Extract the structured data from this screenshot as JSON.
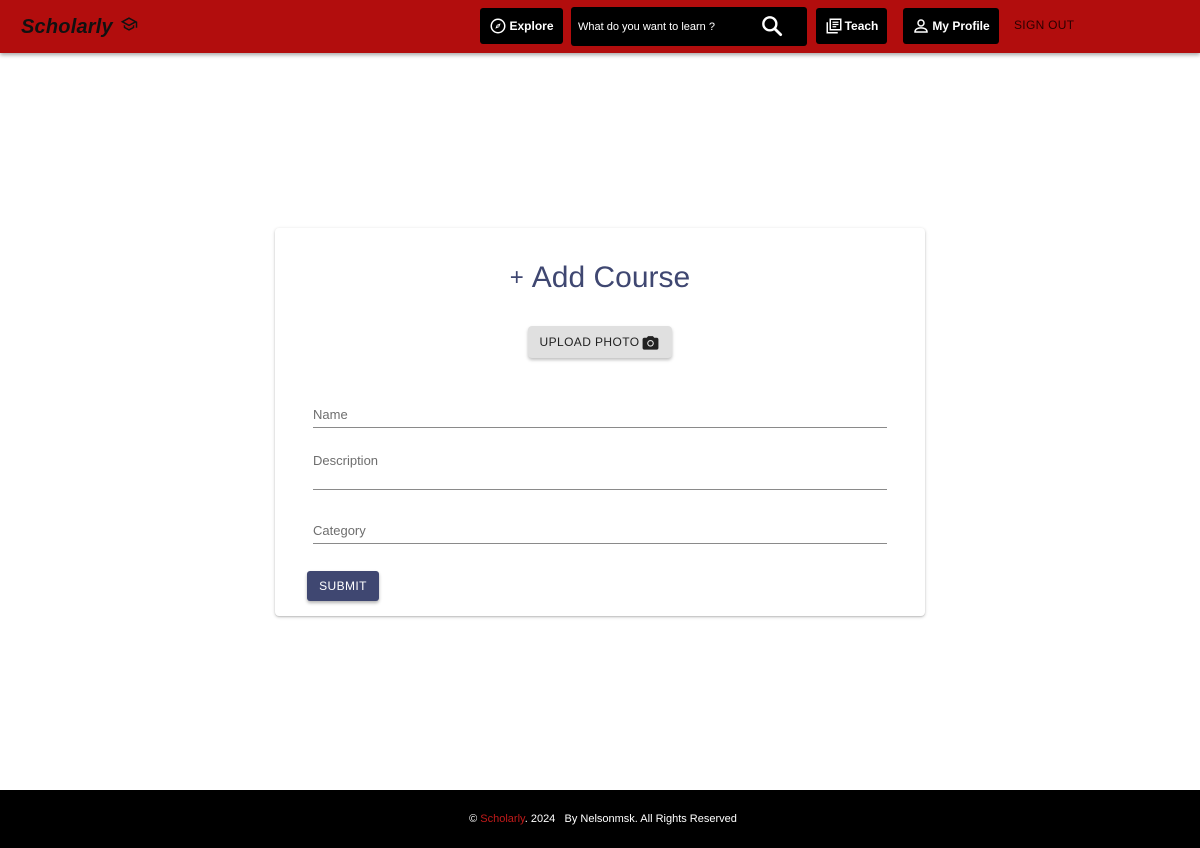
{
  "header": {
    "brand": "Scholarly",
    "brand_icon": "graduation-cap-icon",
    "explore_label": "Explore",
    "search_placeholder": "What do you want to learn ?",
    "teach_label": "Teach",
    "profile_label": "My Profile",
    "signout_label": "SIGN OUT"
  },
  "form": {
    "title_prefix": "+",
    "title": "Add Course",
    "upload_label": "UPLOAD PHOTO",
    "name_placeholder": "Name",
    "description_placeholder": "Description",
    "category_placeholder": "Category",
    "submit_label": "SUBMIT"
  },
  "footer": {
    "copyright": "©",
    "brand": "Scholarly",
    "year_text": ". 2024",
    "credit": "By Nelsonmsk. All Rights Reserved"
  },
  "colors": {
    "header_bg": "#b20d0d",
    "accent": "#3f4771",
    "footer_bg": "#000000"
  }
}
